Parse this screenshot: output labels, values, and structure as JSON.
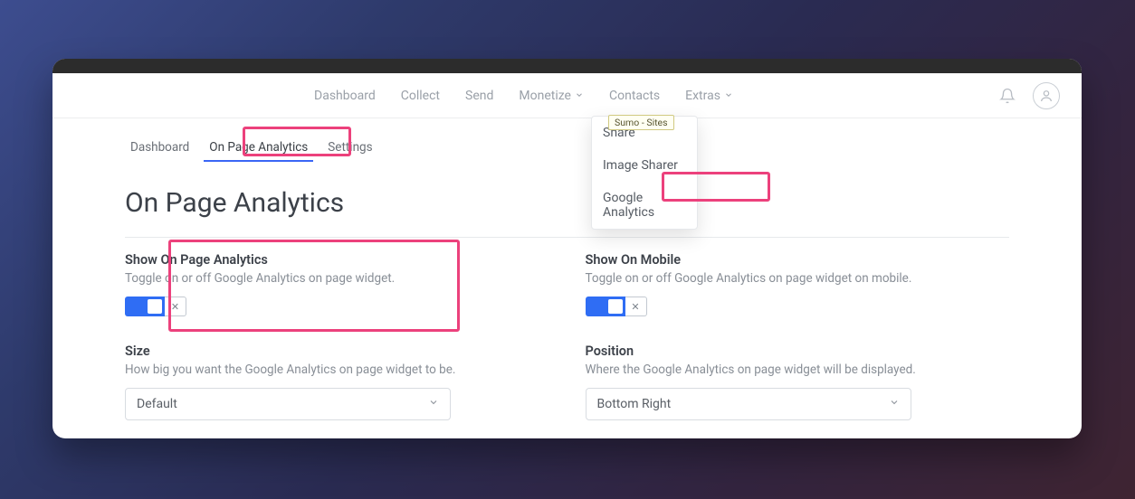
{
  "nav": {
    "items": [
      "Dashboard",
      "Collect",
      "Send",
      "Monetize",
      "Contacts",
      "Extras"
    ],
    "menu_icons": [
      false,
      false,
      false,
      true,
      false,
      true
    ]
  },
  "tabs": {
    "items": [
      "Dashboard",
      "On Page Analytics",
      "Settings"
    ],
    "active": 1
  },
  "page_title": "On Page Analytics",
  "tooltip": "Sumo - Sites",
  "dropdown": {
    "items": [
      "Share",
      "Image Sharer",
      "Google Analytics"
    ]
  },
  "fields": {
    "show_analytics": {
      "title": "Show On Page Analytics",
      "desc": "Toggle on or off Google Analytics on page widget.",
      "value": true
    },
    "show_mobile": {
      "title": "Show On Mobile",
      "desc": "Toggle on or off Google Analytics on page widget on mobile.",
      "value": true
    },
    "size": {
      "title": "Size",
      "desc": "How big you want the Google Analytics on page widget to be.",
      "selected": "Default"
    },
    "position": {
      "title": "Position",
      "desc": "Where the Google Analytics on page widget will be displayed.",
      "selected": "Bottom Right"
    }
  }
}
